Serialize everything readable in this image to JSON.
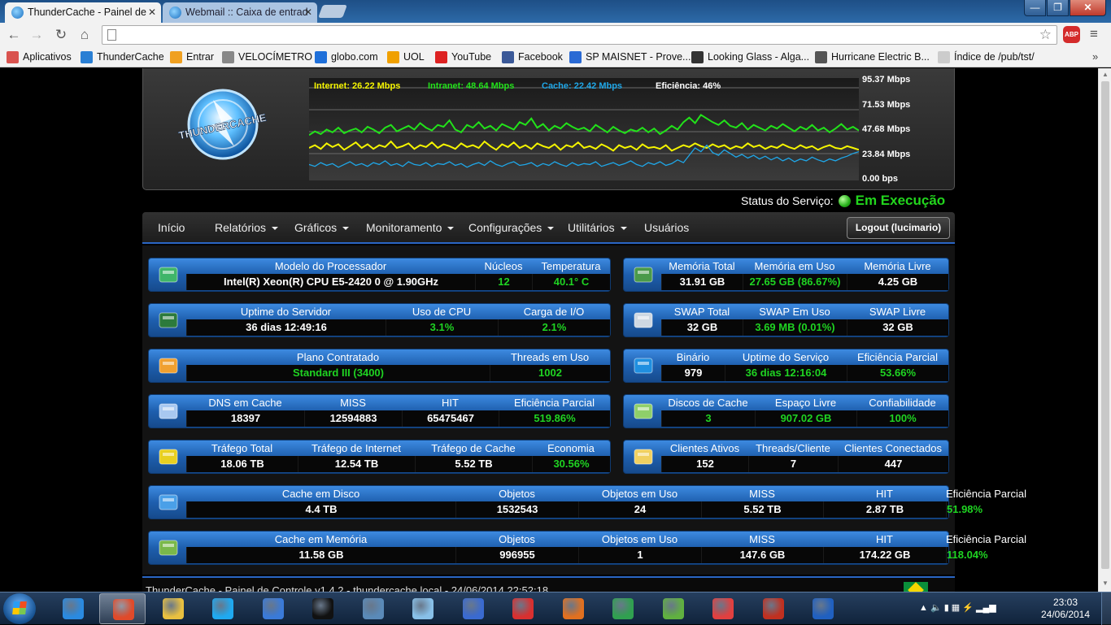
{
  "browser": {
    "tabs": [
      {
        "label": "ThunderCache - Painel de",
        "active": true
      },
      {
        "label": "Webmail :: Caixa de entrad",
        "active": false
      }
    ],
    "window_buttons": {
      "minimize": "—",
      "maximize": "❐",
      "close": "✕"
    },
    "nav": {
      "back": "←",
      "forward": "→",
      "reload": "↻",
      "home": "⌂"
    },
    "address": "",
    "star": "☆",
    "abp": "ABP",
    "menu": "≡",
    "bookmarks": [
      {
        "label": "Aplicativos",
        "icon": "apps-grid-icon",
        "color": "#d9534f"
      },
      {
        "label": "ThunderCache",
        "icon": "thundercache-icon",
        "color": "#2a7fd4"
      },
      {
        "label": "Entrar",
        "icon": "windows-logo-icon",
        "color": "#f0a020"
      },
      {
        "label": "VELOCÍMETRO",
        "icon": "speedometer-icon",
        "color": "#888888"
      },
      {
        "label": "globo.com",
        "icon": "globo-icon",
        "color": "#1e6fd9"
      },
      {
        "label": "UOL",
        "icon": "uol-icon",
        "color": "#f0a000"
      },
      {
        "label": "YouTube",
        "icon": "youtube-icon",
        "color": "#dd2222"
      },
      {
        "label": "Facebook",
        "icon": "facebook-icon",
        "color": "#3b5998"
      },
      {
        "label": "SP MAISNET - Prove...",
        "icon": "spmaisnet-icon",
        "color": "#2a6ad4"
      },
      {
        "label": "Looking Glass - Alga...",
        "icon": "football-icon",
        "color": "#333333"
      },
      {
        "label": "Hurricane Electric B...",
        "icon": "he-icon",
        "color": "#555555"
      },
      {
        "label": "Índice de /pub/tst/",
        "icon": "page-icon",
        "color": "#cccccc"
      }
    ],
    "bookmarks_more": "»"
  },
  "header": {
    "logo_text": "THUNDERCACHE",
    "graph": {
      "legend": [
        {
          "label": "Internet: 26.22 Mbps",
          "color": "#f5f500"
        },
        {
          "label": "Intranet: 48.64 Mbps",
          "color": "#22e21a"
        },
        {
          "label": "Cache: 22.42 Mbps",
          "color": "#1fa7e8"
        },
        {
          "label": "Eficiência: 46%",
          "color": "#ffffff"
        }
      ],
      "y_ticks": [
        "95.37 Mbps",
        "71.53 Mbps",
        "47.68 Mbps",
        "23.84 Mbps",
        "0.00 bps"
      ]
    }
  },
  "chart_data": {
    "type": "line",
    "title": "",
    "xlabel": "",
    "ylabel": "",
    "ylim": [
      0,
      95.37
    ],
    "series": [
      {
        "name": "Intranet",
        "color": "#22e21a",
        "values": [
          44,
          48,
          45,
          50,
          47,
          52,
          46,
          49,
          51,
          47,
          53,
          50,
          46,
          52,
          55,
          48,
          51,
          54,
          50,
          57,
          52,
          49,
          55,
          53,
          60,
          50,
          47,
          55,
          52,
          58,
          51,
          54,
          49,
          56,
          53,
          50,
          58,
          55,
          62,
          52,
          56,
          49,
          54,
          51,
          57,
          53,
          50,
          52,
          48,
          55,
          51,
          47,
          53,
          49,
          46,
          50,
          48,
          52,
          47,
          51,
          45,
          49,
          54,
          50,
          58,
          63,
          57,
          66,
          62,
          58,
          55,
          60,
          54,
          52,
          57,
          50,
          55,
          52,
          49,
          54,
          51,
          56,
          52,
          48,
          53,
          50,
          55,
          49,
          52,
          47,
          51,
          56,
          50,
          53,
          49
        ]
      },
      {
        "name": "Internet",
        "color": "#f5f500",
        "values": [
          30,
          33,
          29,
          35,
          31,
          34,
          28,
          32,
          36,
          30,
          34,
          29,
          33,
          31,
          37,
          30,
          32,
          35,
          29,
          33,
          31,
          36,
          30,
          34,
          32,
          29,
          35,
          31,
          33,
          30,
          37,
          32,
          28,
          34,
          31,
          36,
          30,
          33,
          29,
          35,
          32,
          30,
          34,
          28,
          33,
          31,
          36,
          30,
          32,
          29,
          34,
          31,
          27,
          33,
          30,
          32,
          28,
          34,
          30,
          31,
          29,
          33,
          27,
          30,
          33,
          31,
          35,
          32,
          30,
          34,
          31,
          33,
          29,
          32,
          30,
          35,
          31,
          33,
          29,
          32,
          30,
          34,
          31,
          29,
          33,
          30,
          32,
          28,
          31,
          33,
          30,
          29,
          32,
          30,
          28
        ]
      },
      {
        "name": "Cache",
        "color": "#1fa7e8",
        "values": [
          12,
          10,
          14,
          11,
          13,
          9,
          12,
          15,
          11,
          13,
          10,
          14,
          12,
          16,
          11,
          13,
          10,
          15,
          12,
          11,
          14,
          10,
          13,
          12,
          15,
          11,
          13,
          9,
          12,
          14,
          11,
          16,
          12,
          10,
          13,
          15,
          11,
          12,
          14,
          10,
          13,
          11,
          15,
          12,
          10,
          14,
          11,
          13,
          12,
          15,
          10,
          12,
          14,
          11,
          13,
          16,
          12,
          10,
          14,
          12,
          15,
          11,
          13,
          17,
          14,
          22,
          30,
          26,
          33,
          25,
          22,
          28,
          24,
          20,
          23,
          19,
          22,
          18,
          21,
          17,
          20,
          16,
          19,
          15,
          18,
          16,
          20,
          17,
          15,
          18,
          16,
          19,
          21,
          24,
          26
        ]
      }
    ]
  },
  "status": {
    "label": "Status do Serviço:",
    "value": "Em Execução"
  },
  "nav": {
    "items": [
      {
        "label": "Início",
        "dropdown": false
      },
      {
        "label": "Relatórios",
        "dropdown": true
      },
      {
        "label": "Gráficos",
        "dropdown": true
      },
      {
        "label": "Monitoramento",
        "dropdown": true
      },
      {
        "label": "Configurações",
        "dropdown": true
      },
      {
        "label": "Utilitários",
        "dropdown": true
      },
      {
        "label": "Usuários",
        "dropdown": false
      }
    ],
    "logout": "Logout (lucimario)"
  },
  "panels": {
    "processor": {
      "icon": "cpu-chip-icon",
      "cols": [
        {
          "h": "Modelo do Processador",
          "v": "Intel(R) Xeon(R) CPU E5-2420 0 @ 1.90GHz",
          "green": false
        },
        {
          "h": "Núcleos",
          "v": "12",
          "green": true
        },
        {
          "h": "Temperatura",
          "v": "40.1° C",
          "green": true
        }
      ]
    },
    "memory": {
      "icon": "memory-module-icon",
      "cols": [
        {
          "h": "Memória Total",
          "v": "31.91 GB",
          "green": false
        },
        {
          "h": "Memória em Uso",
          "v": "27.65 GB (86.67%)",
          "green": true
        },
        {
          "h": "Memória Livre",
          "v": "4.25 GB",
          "green": false
        }
      ]
    },
    "uptime": {
      "icon": "activity-monitor-icon",
      "cols": [
        {
          "h": "Uptime do Servidor",
          "v": "36 dias 12:49:16",
          "green": false
        },
        {
          "h": "Uso de CPU",
          "v": "3.1%",
          "green": true
        },
        {
          "h": "Carga de I/O",
          "v": "2.1%",
          "green": true
        }
      ]
    },
    "swap": {
      "icon": "swap-drive-icon",
      "cols": [
        {
          "h": "SWAP Total",
          "v": "32 GB",
          "green": false
        },
        {
          "h": "SWAP Em Uso",
          "v": "3.69 MB (0.01%)",
          "green": true
        },
        {
          "h": "SWAP Livre",
          "v": "32 GB",
          "green": false
        }
      ]
    },
    "plan": {
      "icon": "network-branch-icon",
      "cols": [
        {
          "h": "Plano Contratado",
          "v": "Standard III (3400)",
          "green": true
        },
        {
          "h": "Threads em Uso",
          "v": "1002",
          "green": true
        }
      ]
    },
    "binary": {
      "icon": "globe-icon",
      "cols": [
        {
          "h": "Binário",
          "v": "979",
          "green": false
        },
        {
          "h": "Uptime do Serviço",
          "v": "36 dias 12:16:04",
          "green": true
        },
        {
          "h": "Eficiência Parcial",
          "v": "53.66%",
          "green": true
        }
      ]
    },
    "dns": {
      "icon": "dns-server-icon",
      "cols": [
        {
          "h": "DNS em Cache",
          "v": "18397",
          "green": false
        },
        {
          "h": "MISS",
          "v": "12594883",
          "green": false
        },
        {
          "h": "HIT",
          "v": "65475467",
          "green": false
        },
        {
          "h": "Eficiência Parcial",
          "v": "519.86%",
          "green": true
        }
      ]
    },
    "disks": {
      "icon": "disk-drive-icon",
      "cols": [
        {
          "h": "Discos de Cache",
          "v": "3",
          "green": true
        },
        {
          "h": "Espaço Livre",
          "v": "907.02 GB",
          "green": true
        },
        {
          "h": "Confiabilidade",
          "v": "100%",
          "green": true
        }
      ]
    },
    "traffic": {
      "icon": "bar-chart-icon",
      "cols": [
        {
          "h": "Tráfego Total",
          "v": "18.06 TB",
          "green": false
        },
        {
          "h": "Tráfego de Internet",
          "v": "12.54 TB",
          "green": false
        },
        {
          "h": "Tráfego de Cache",
          "v": "5.52 TB",
          "green": false
        },
        {
          "h": "Economia",
          "v": "30.56%",
          "green": true
        }
      ]
    },
    "clients": {
      "icon": "clients-computer-icon",
      "cols": [
        {
          "h": "Clientes Ativos",
          "v": "152",
          "green": false
        },
        {
          "h": "Threads/Cliente",
          "v": "7",
          "green": false
        },
        {
          "h": "Clientes Conectados",
          "v": "447",
          "green": false
        }
      ]
    },
    "disk_cache": {
      "icon": "disk-stack-icon",
      "cols": [
        {
          "h": "Cache em Disco",
          "v": "4.4 TB",
          "green": false
        },
        {
          "h": "Objetos",
          "v": "1532543",
          "green": false
        },
        {
          "h": "Objetos em Uso",
          "v": "24",
          "green": false
        },
        {
          "h": "MISS",
          "v": "5.52 TB",
          "green": false
        },
        {
          "h": "HIT",
          "v": "2.87 TB",
          "green": false
        },
        {
          "h": "Eficiência Parcial",
          "v": "51.98%",
          "green": true
        }
      ]
    },
    "mem_cache": {
      "icon": "ram-chip-icon",
      "cols": [
        {
          "h": "Cache em Memória",
          "v": "11.58 GB",
          "green": false
        },
        {
          "h": "Objetos",
          "v": "996955",
          "green": false
        },
        {
          "h": "Objetos em Uso",
          "v": "1",
          "green": false
        },
        {
          "h": "MISS",
          "v": "147.6 GB",
          "green": false
        },
        {
          "h": "HIT",
          "v": "174.22 GB",
          "green": false
        },
        {
          "h": "Eficiência Parcial",
          "v": "118.04%",
          "green": true
        }
      ]
    }
  },
  "footer": {
    "text": "ThunderCache - Painel de Controle v1.4.2 - thundercache.local - 24/06/2014 22:52:18"
  },
  "taskbar": {
    "apps": [
      {
        "name": "internet-explorer-icon",
        "color": "#2a8ae0"
      },
      {
        "name": "chrome-icon",
        "color": "#e04a2a",
        "active": true
      },
      {
        "name": "folder-icon",
        "color": "#e8c040"
      },
      {
        "name": "skype-icon",
        "color": "#1fa9f0"
      },
      {
        "name": "app-moon-icon",
        "color": "#3a7ad8"
      },
      {
        "name": "cmd-icon",
        "color": "#111111"
      },
      {
        "name": "security-icon",
        "color": "#5a8ab8"
      },
      {
        "name": "notes-icon",
        "color": "#88c0e8"
      },
      {
        "name": "network-tool-icon",
        "color": "#3a6ad0"
      },
      {
        "name": "house-icon",
        "color": "#d83030"
      },
      {
        "name": "java-icon",
        "color": "#e07020"
      },
      {
        "name": "remote-desktop-icon",
        "color": "#30a050"
      },
      {
        "name": "magnifier-icon",
        "color": "#60b040"
      },
      {
        "name": "camera-icon",
        "color": "#e04040"
      },
      {
        "name": "bridge-icon",
        "color": "#c03020"
      },
      {
        "name": "weather-icon",
        "color": "#2060c0"
      }
    ],
    "tray": "▲   🔈  ▮  ▦  ⚡  ▂▄▆",
    "time": "23:03",
    "date": "24/06/2014"
  }
}
